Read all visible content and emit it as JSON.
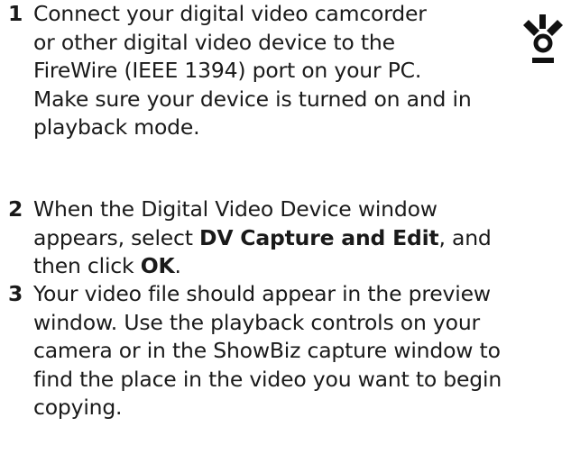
{
  "steps": [
    {
      "number": "1",
      "lines": [
        "Connect your digital video camcorder",
        "or other digital video device to the",
        "FireWire (IEEE 1394) port on your PC.",
        "Make sure your device is turned on and in",
        "playback mode."
      ]
    },
    {
      "number": "2",
      "line1": "When the Digital Video Device window",
      "line2_pre": "appears, select ",
      "line2_bold": "DV Capture and Edit",
      "line2_post": ", and",
      "line3_pre": "then click ",
      "line3_bold": "OK",
      "line3_post": "."
    },
    {
      "number": "3",
      "lines": [
        "Your video file should appear in the preview",
        "window. Use the playback controls on your",
        "camera or in the ShowBiz capture window to",
        "find the place in the video you want to begin",
        "copying."
      ]
    }
  ],
  "icons": {
    "firewire": "firewire-icon",
    "color": "#111111"
  }
}
